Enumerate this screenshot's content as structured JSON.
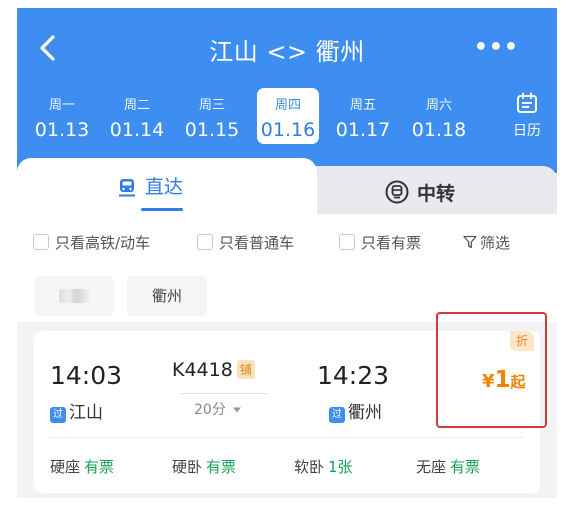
{
  "header": {
    "title": "江山 <> 衢州",
    "more_label": "•••"
  },
  "dates": [
    {
      "weekday": "周一",
      "date": "01.13",
      "selected": false
    },
    {
      "weekday": "周二",
      "date": "01.14",
      "selected": false
    },
    {
      "weekday": "周三",
      "date": "01.15",
      "selected": false
    },
    {
      "weekday": "周四",
      "date": "01.16",
      "selected": true
    },
    {
      "weekday": "周五",
      "date": "01.17",
      "selected": false
    },
    {
      "weekday": "周六",
      "date": "01.18",
      "selected": false
    }
  ],
  "calendar_label": "日历",
  "tabs": {
    "direct": "直达",
    "transfer": "中转"
  },
  "filters": {
    "high_speed": "只看高铁/动车",
    "ordinary": "只看普通车",
    "with_tickets": "只看有票",
    "screen": "筛选"
  },
  "station_chips": {
    "arrival": "衢州"
  },
  "train": {
    "depart_time": "14:03",
    "depart_station": "江山",
    "number": "K4418",
    "number_badge": "铺",
    "duration": "20分",
    "arrive_time": "14:23",
    "arrive_station": "衢州",
    "via_badge": "过",
    "discount_badge": "折",
    "price_symbol": "¥",
    "price_value": "1",
    "price_suffix": "起",
    "seats": [
      {
        "type": "硬座",
        "status": "有票"
      },
      {
        "type": "硬卧",
        "status": "有票"
      },
      {
        "type": "软卧",
        "status": "1张"
      },
      {
        "type": "无座",
        "status": "有票"
      }
    ]
  },
  "colors": {
    "header_blue": "#3d8ef0",
    "accent_blue": "#2f7de8",
    "price_orange": "#f08300",
    "available_green": "#18a058",
    "highlight_red": "#d23a3a"
  }
}
